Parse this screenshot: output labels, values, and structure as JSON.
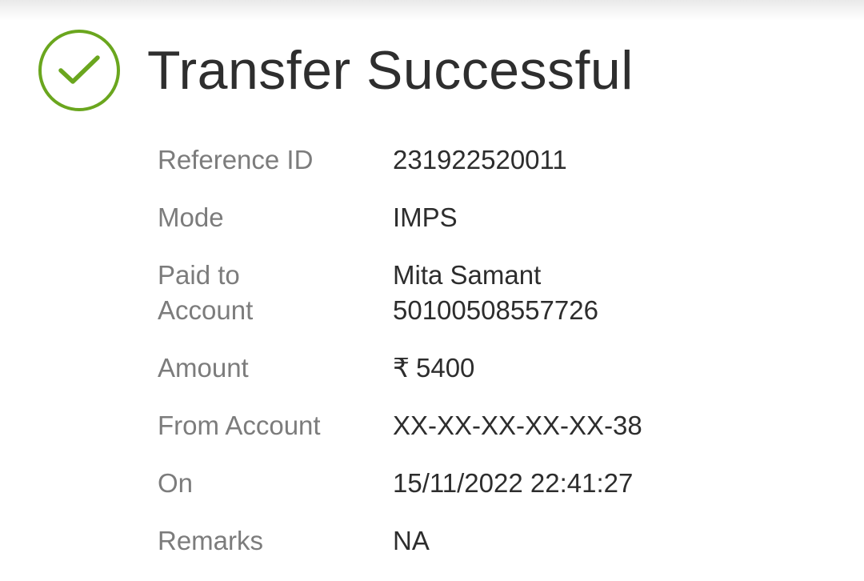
{
  "header": {
    "title": "Transfer Successful",
    "status_icon": "check-circle-icon",
    "accent_color": "#6aa61e"
  },
  "details": {
    "reference_id": {
      "label": "Reference ID",
      "value": "231922520011"
    },
    "mode": {
      "label": "Mode",
      "value": "IMPS"
    },
    "paid_to": {
      "label_line1": "Paid to",
      "label_line2": "Account",
      "name": "Mita Samant",
      "account_number": "50100508557726"
    },
    "amount": {
      "label": "Amount",
      "currency_symbol": "₹",
      "value": "5400"
    },
    "from_account": {
      "label": "From Account",
      "value": "XX-XX-XX-XX-XX-38"
    },
    "on": {
      "label": "On",
      "value": "15/11/2022 22:41:27"
    },
    "remarks": {
      "label": "Remarks",
      "value": "NA"
    }
  }
}
